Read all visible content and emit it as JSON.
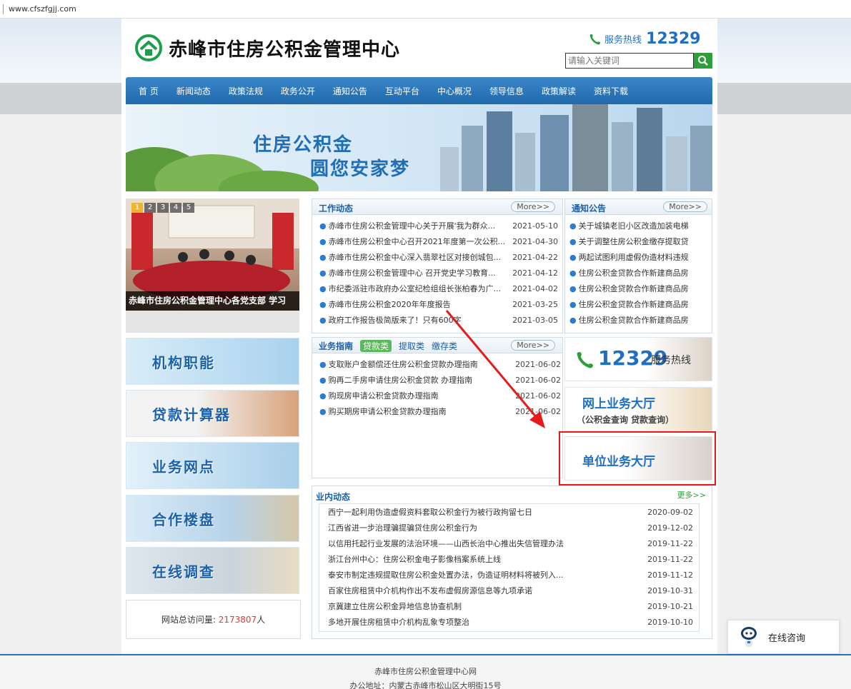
{
  "browser": {
    "url": "www.cfszfgjj.com"
  },
  "header": {
    "site_title": "赤峰市住房公积金管理中心",
    "hotline_label": "服务热线",
    "hotline_number": "12329",
    "search_placeholder": "请输入关键词"
  },
  "nav": {
    "items": [
      "首 页",
      "新闻动态",
      "政策法规",
      "政务公开",
      "通知公告",
      "互动平台",
      "中心概况",
      "领导信息",
      "政策解读",
      "资料下载"
    ]
  },
  "banner": {
    "line1": "住房公积金",
    "line2": "圆您安家梦"
  },
  "slider": {
    "pages": [
      "1",
      "2",
      "3",
      "4",
      "5"
    ],
    "caption": "赤峰市住房公积金管理中心各党支部 学习"
  },
  "side_buttons": [
    "机构职能",
    "贷款计算器",
    "业务网点",
    "合作楼盘",
    "在线调查"
  ],
  "visits": {
    "label": "网站总访问量:",
    "count": "2173807",
    "unit": "人"
  },
  "work": {
    "title": "工作动态",
    "more": "More>>",
    "items": [
      {
        "text": "赤峰市住房公积金管理中心关于开展'我为群众...",
        "date": "2021-05-10"
      },
      {
        "text": "赤峰市住房公积金中心召开2021年度第一次公积...",
        "date": "2021-04-30"
      },
      {
        "text": "赤峰市住房公积金中心深入翡翠社区对接创城包...",
        "date": "2021-04-22"
      },
      {
        "text": "赤峰市住房公积金管理中心 召开党史学习教育...",
        "date": "2021-04-12"
      },
      {
        "text": "市纪委派驻市政府办公室纪检组组长张柏春为广...",
        "date": "2021-04-02"
      },
      {
        "text": "赤峰市住房公积金2020年年度报告",
        "date": "2021-03-25"
      },
      {
        "text": "政府工作报告极简版来了！只有600字",
        "date": "2021-03-05"
      }
    ]
  },
  "notice": {
    "title": "通知公告",
    "more": "More>>",
    "items": [
      "关于城镇老旧小区改造加装电梯",
      "关于调整住房公积金缴存提取贷",
      "两起试图利用虚假伪造材料违规",
      "住房公积金贷款合作新建商品房",
      "住房公积金贷款合作新建商品房",
      "住房公积金贷款合作新建商品房",
      "住房公积金贷款合作新建商品房"
    ]
  },
  "guide": {
    "tabs": [
      "业务指南",
      "贷款类",
      "提取类",
      "缴存类"
    ],
    "more": "More>>",
    "items": [
      {
        "text": "支取账户金额偿还住房公积金贷款办理指南",
        "date": "2021-06-02"
      },
      {
        "text": "购再二手房申请住房公积金贷款 办理指南",
        "date": "2021-06-02"
      },
      {
        "text": "购现房申请公积金贷款办理指南",
        "date": "2021-06-02"
      },
      {
        "text": "购买期房申请公积金贷款办理指南",
        "date": "2021-06-02"
      }
    ]
  },
  "tiles": {
    "hotline_num": "12329",
    "hotline_label": "服务热线",
    "online_title": "网上业务大厅",
    "online_sub": "（公积金查询   贷款查询）",
    "unit_title": "单位业务大厅"
  },
  "industry": {
    "title": "业内动态",
    "more": "更多>>",
    "items": [
      {
        "text": "西宁一起利用伪造虚假资料套取公积金行为被行政拘留七日",
        "date": "2020-09-02"
      },
      {
        "text": "江西省进一步治理骗提骗贷住房公积金行为",
        "date": "2019-12-02"
      },
      {
        "text": "以信用托起行业发展的法治环境——山西长治中心推出失信管理办法",
        "date": "2019-11-22"
      },
      {
        "text": "浙江台州中心：住房公积金电子影像档案系统上线",
        "date": "2019-11-22"
      },
      {
        "text": "泰安市制定违规提取住房公积金处置办法，伪造证明材料将被列入...",
        "date": "2019-11-12"
      },
      {
        "text": "百家住房租赁中介机构作出不发布虚假房源信息等九项承诺",
        "date": "2019-10-31"
      },
      {
        "text": "京冀建立住房公积金异地信息协查机制",
        "date": "2019-10-21"
      },
      {
        "text": "多地开展住房租赁中介机构乱象专项整治",
        "date": "2019-10-10"
      }
    ]
  },
  "footer": {
    "line1": "赤峰市住房公积金管理中心网",
    "line2": "办公地址：内蒙古赤峰市松山区大明街15号"
  },
  "consult": {
    "label": "在线咨询"
  },
  "colors": {
    "brand_blue": "#1f6fc4",
    "nav_blue": "#2a75b9",
    "accent_green": "#2e9e3a",
    "highlight_red": "#e51c1c",
    "visit_red": "#e03c31"
  }
}
